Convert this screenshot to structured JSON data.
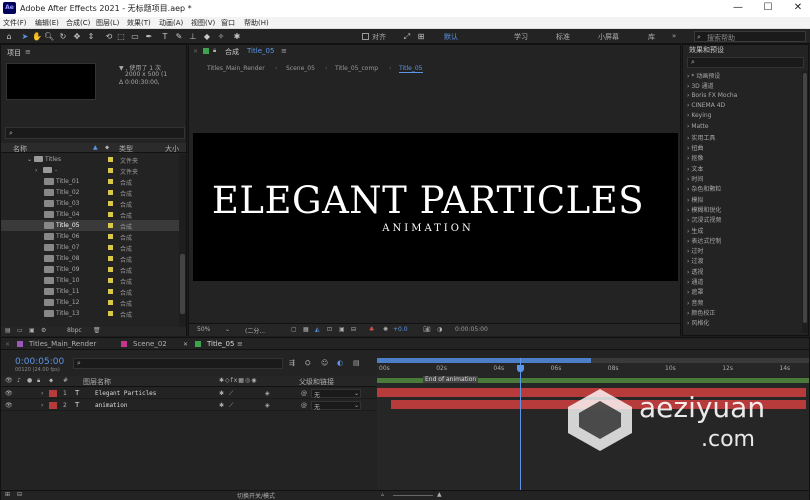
{
  "window": {
    "logo": "Ae",
    "title": "Adobe After Effects 2021 - 无标题项目.aep *",
    "minimize": "—",
    "maximize": "☐",
    "close": "✕"
  },
  "menu": [
    "文件(F)",
    "编辑(E)",
    "合成(C)",
    "图层(L)",
    "效果(T)",
    "动画(A)",
    "视图(V)",
    "窗口",
    "帮助(H)"
  ],
  "toolbar": {
    "align_label": "对齐",
    "workspaces": [
      "默认",
      "学习",
      "标准",
      "小屏幕",
      "库"
    ],
    "active_workspace": "默认",
    "search_placeholder": "搜索帮助"
  },
  "project": {
    "title": "项目",
    "info_line1": "▼ , 使用了 1 次",
    "info_line2": "2000 x 500 (1",
    "info_line3": "Δ 0:00:30:00,",
    "search_placeholder": "",
    "columns": [
      "名称",
      "类型",
      "大小"
    ],
    "folder_name": "Titles",
    "folder_type": "文件夹",
    "subfolder_name": "-",
    "subfolder_type": "文件夹",
    "items": [
      {
        "name": "Title_01",
        "type": "合成"
      },
      {
        "name": "Title_02",
        "type": "合成"
      },
      {
        "name": "Title_03",
        "type": "合成"
      },
      {
        "name": "Title_04",
        "type": "合成"
      },
      {
        "name": "Title_05",
        "type": "合成"
      },
      {
        "name": "Title_06",
        "type": "合成"
      },
      {
        "name": "Title_07",
        "type": "合成"
      },
      {
        "name": "Title_08",
        "type": "合成"
      },
      {
        "name": "Title_09",
        "type": "合成"
      },
      {
        "name": "Title_10",
        "type": "合成"
      },
      {
        "name": "Title_11",
        "type": "合成"
      },
      {
        "name": "Title_12",
        "type": "合成"
      },
      {
        "name": "Title_13",
        "type": "合成"
      }
    ],
    "selected_item": "Title_05",
    "bpc": "8bpc"
  },
  "composition": {
    "panel_label": "合成",
    "panel_name": "Title_05",
    "breadcrumbs": [
      "Titles_Main_Render",
      "Scene_05",
      "Title_05_comp",
      "Title_05"
    ],
    "active_crumb": "Title_05",
    "title_text": "ELEGANT PARTICLES",
    "subtitle_text": "ANIMATION",
    "zoom": "50%",
    "resolution": "(二分...",
    "exposure": "+0.0",
    "timecode": "0:00:05:00"
  },
  "effects": {
    "title": "效果和预设",
    "search_placeholder": "",
    "categories": [
      "* 动画预设",
      "3D 通道",
      "Boris FX Mocha",
      "CINEMA 4D",
      "Keying",
      "Matte",
      "实用工具",
      "扭曲",
      "抠像",
      "文本",
      "时间",
      "杂色和颗粒",
      "模拟",
      "模糊和锐化",
      "沉浸式视频",
      "生成",
      "表达式控制",
      "过时",
      "过渡",
      "透视",
      "通道",
      "遮罩",
      "音频",
      "颜色校正",
      "风格化"
    ]
  },
  "timeline": {
    "tabs": [
      "Titles_Main_Render",
      "Scene_02",
      "Title_05"
    ],
    "active_tab": "Title_05",
    "tab_colors": [
      "#9b59b6",
      "#c0398a",
      "#3fa34d"
    ],
    "timecode": "0:00:05:00",
    "timecode_sub": "00120 (24.00 fps)",
    "search_placeholder": "",
    "columns": [
      "图层名称",
      "父级和链接"
    ],
    "layers": [
      {
        "num": "1",
        "type": "T",
        "name": "Elegant Particles",
        "parent": "无"
      },
      {
        "num": "2",
        "type": "T",
        "name": "animation",
        "parent": "无"
      }
    ],
    "ticks": [
      "00s",
      "02s",
      "04s",
      "06s",
      "08s",
      "10s",
      "12s",
      "14s"
    ],
    "marker_label": "End of animation",
    "toggle_label": "切换开关/模式",
    "playhead_time_s": 5,
    "duration_s": 15,
    "layer_bars": [
      {
        "start_s": 0.0,
        "end_s": 15.0,
        "color": "#b83b3b"
      },
      {
        "start_s": 0.5,
        "end_s": 15.0,
        "color": "#b83b3b"
      }
    ]
  },
  "watermark": {
    "main": "aeziyuan",
    "sub": ".com"
  }
}
